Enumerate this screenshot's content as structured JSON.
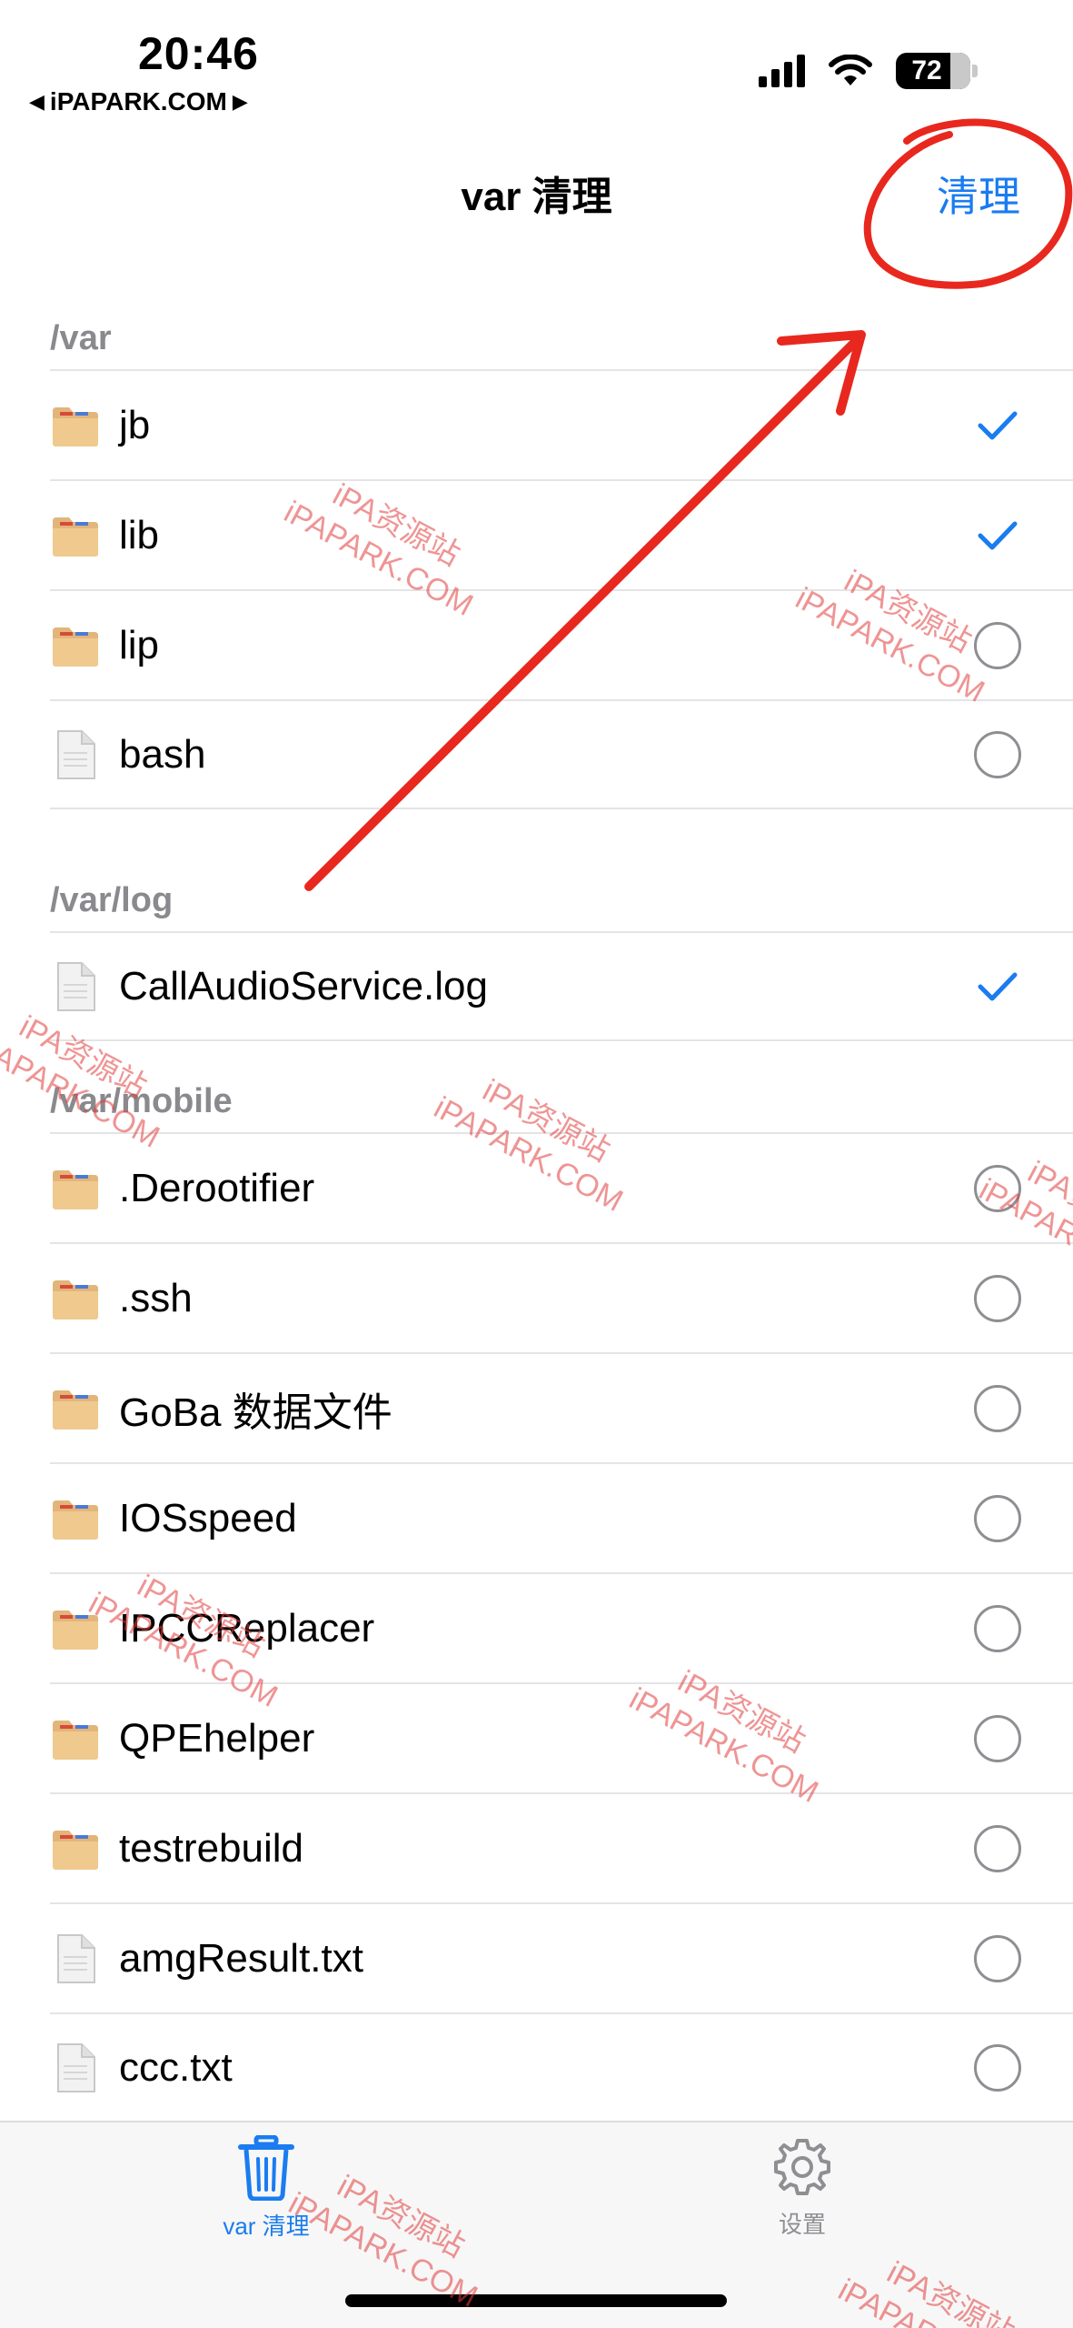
{
  "status_bar": {
    "time": "20:46",
    "back_label": "iPAPARK.COM",
    "battery": "72"
  },
  "nav": {
    "title": "var 清理",
    "action_label": "清理"
  },
  "sections": [
    {
      "header": "/var",
      "items": [
        {
          "name": "jb",
          "type": "folder",
          "selected": true
        },
        {
          "name": "lib",
          "type": "folder",
          "selected": true
        },
        {
          "name": "lip",
          "type": "folder",
          "selected": false
        },
        {
          "name": "bash",
          "type": "file",
          "selected": false
        }
      ]
    },
    {
      "header": "/var/log",
      "items": [
        {
          "name": "CallAudioService.log",
          "type": "file",
          "selected": true
        }
      ]
    },
    {
      "header": "/var/mobile",
      "items": [
        {
          "name": ".Derootifier",
          "type": "folder",
          "selected": false
        },
        {
          "name": ".ssh",
          "type": "folder",
          "selected": false
        },
        {
          "name": "GoBa 数据文件",
          "type": "folder",
          "selected": false
        },
        {
          "name": "IOSspeed",
          "type": "folder",
          "selected": false
        },
        {
          "name": "IPCCReplacer",
          "type": "folder",
          "selected": false
        },
        {
          "name": "QPEhelper",
          "type": "folder",
          "selected": false
        },
        {
          "name": "testrebuild",
          "type": "folder",
          "selected": false
        },
        {
          "name": "amgResult.txt",
          "type": "file",
          "selected": false
        },
        {
          "name": "ccc.txt",
          "type": "file",
          "selected": false
        }
      ]
    }
  ],
  "tab_bar": {
    "tabs": [
      {
        "label": "var 清理",
        "icon": "trash-icon",
        "active": true
      },
      {
        "label": "设置",
        "icon": "gear-icon",
        "active": false
      }
    ]
  },
  "watermark": {
    "line1": "iPA资源站",
    "line2": "iPAPARK.COM"
  },
  "colors": {
    "accent": "#1a7cf0",
    "annotation": "#e8281e",
    "section_header": "#8a8a8e"
  }
}
